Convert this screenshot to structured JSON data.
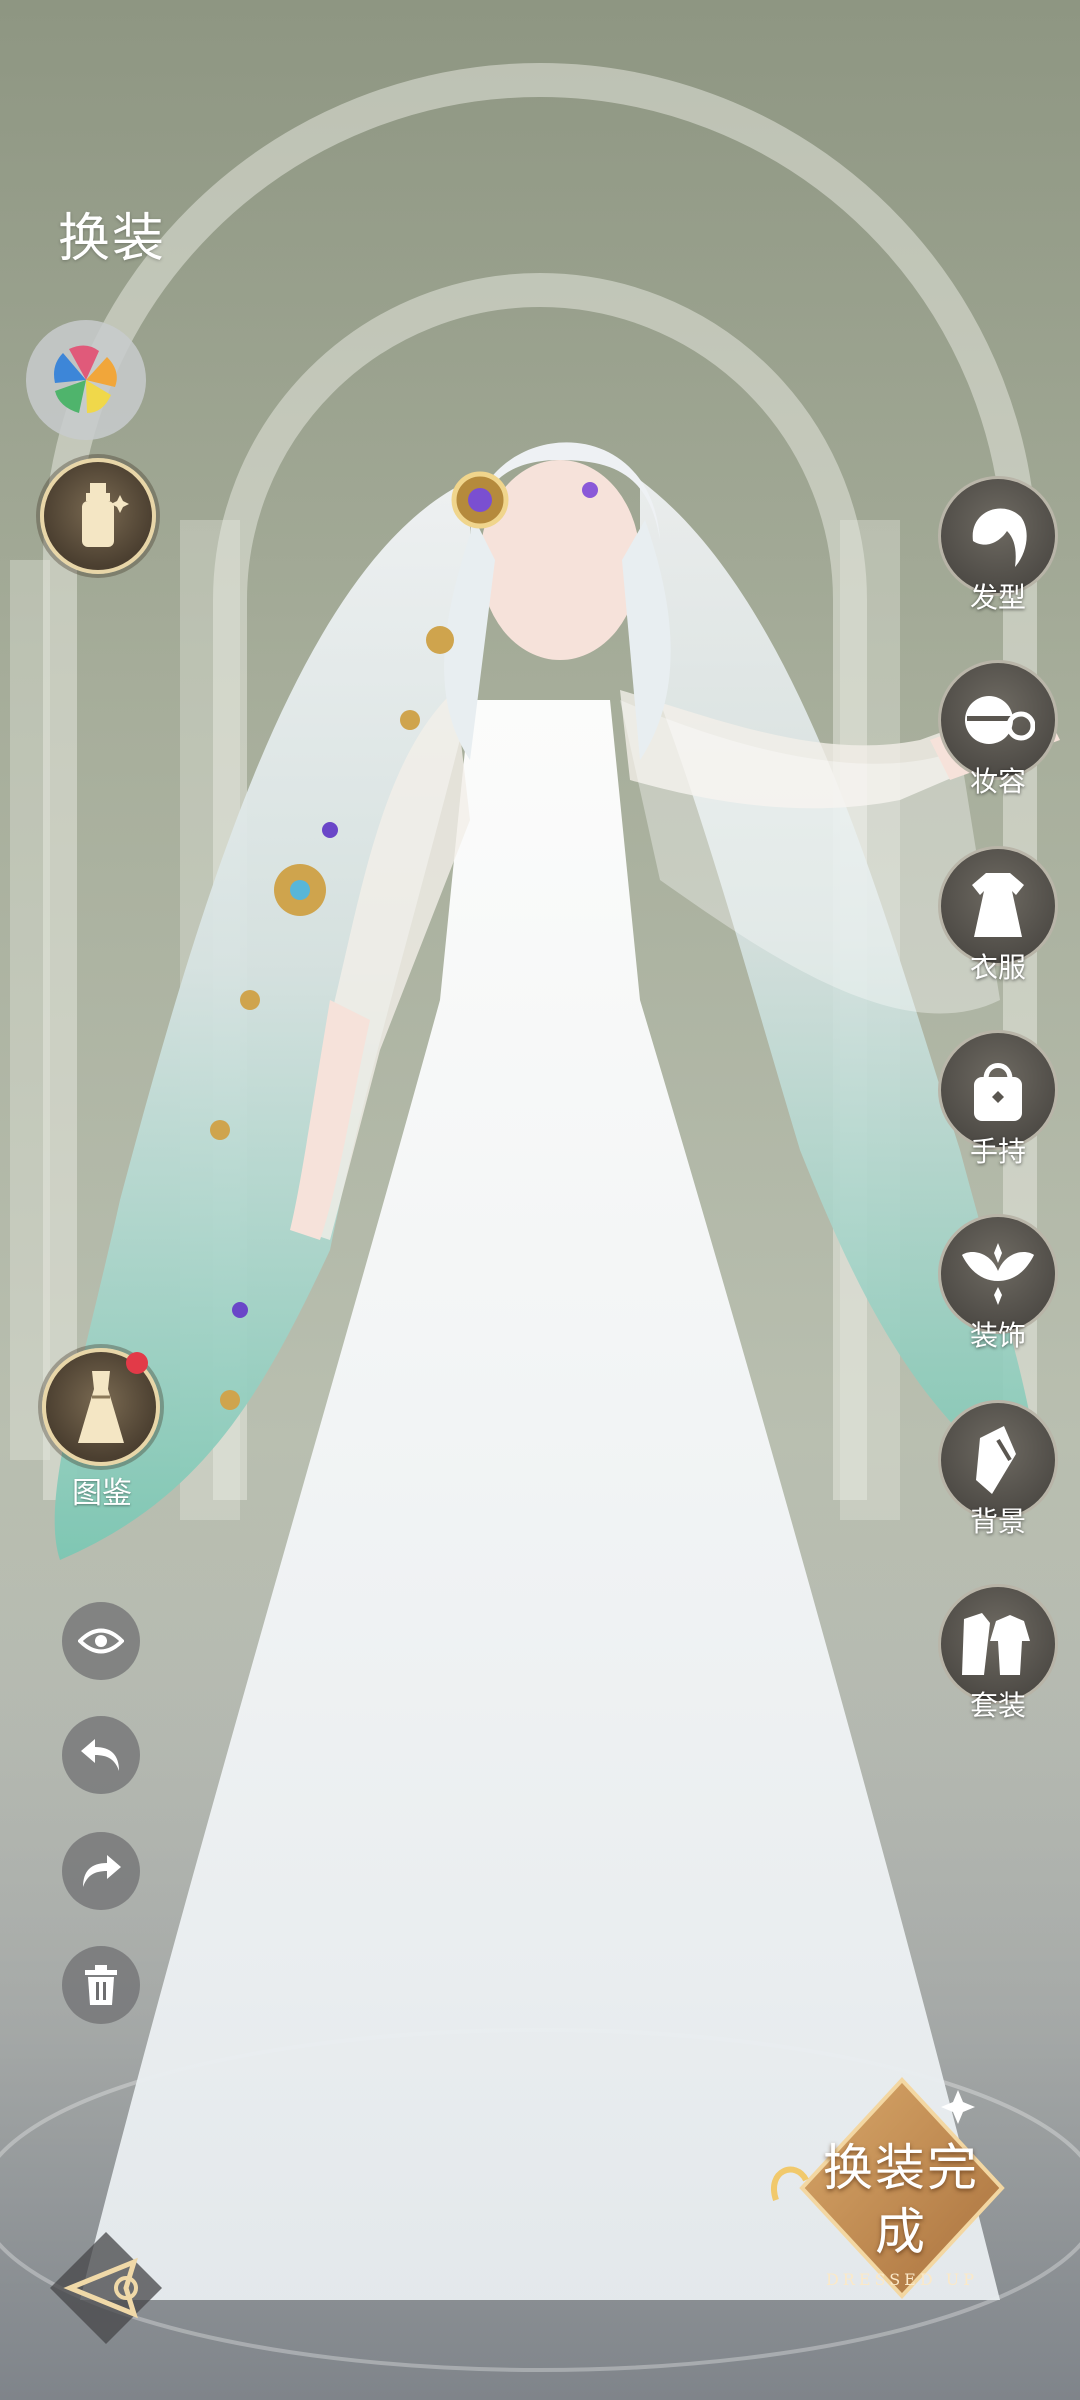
{
  "header": {
    "title": "换装"
  },
  "left_tools": {
    "catalog_label": "图鉴"
  },
  "right_menu": [
    {
      "label": "发型",
      "icon": "hair-icon"
    },
    {
      "label": "妆容",
      "icon": "makeup-icon"
    },
    {
      "label": "衣服",
      "icon": "clothes-icon"
    },
    {
      "label": "手持",
      "icon": "handheld-bag-icon"
    },
    {
      "label": "装饰",
      "icon": "wings-accessory-icon"
    },
    {
      "label": "背景",
      "icon": "background-icon"
    },
    {
      "label": "套装",
      "icon": "outfit-set-icon"
    }
  ],
  "done_button": {
    "main_label": "换装完成",
    "sub_label": "DRESSED UP"
  },
  "colors": {
    "accent_gold": "#e8d6a8",
    "badge_red": "#e23a48"
  }
}
